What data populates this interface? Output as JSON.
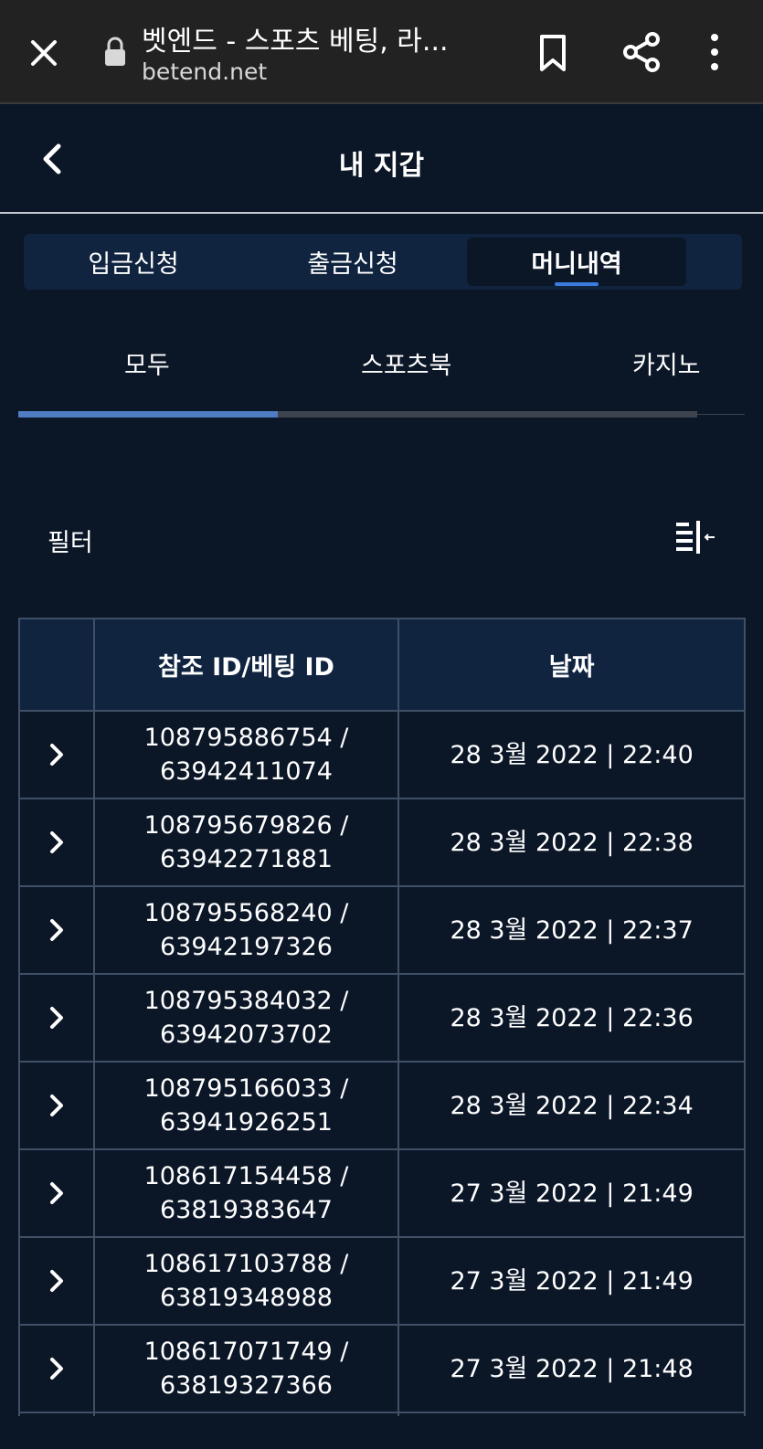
{
  "browser": {
    "title": "벳엔드 - 스포츠 베팅, 라...",
    "url": "betend.net"
  },
  "header": {
    "title": "내 지갑"
  },
  "main_tabs": [
    {
      "label": "입금신청"
    },
    {
      "label": "출금신청"
    },
    {
      "label": "머니내역"
    }
  ],
  "sub_tabs": [
    {
      "label": "모두"
    },
    {
      "label": "스포츠북"
    },
    {
      "label": "카지노"
    }
  ],
  "filter": {
    "label": "필터"
  },
  "table": {
    "headers": {
      "arrow": "",
      "id": "참조 ID/베팅 ID",
      "date": "날짜"
    },
    "rows": [
      {
        "ref": "108795886754 /",
        "bet": "63942411074",
        "date": "28 3월 2022 | 22:40"
      },
      {
        "ref": "108795679826 /",
        "bet": "63942271881",
        "date": "28 3월 2022 | 22:38"
      },
      {
        "ref": "108795568240 /",
        "bet": "63942197326",
        "date": "28 3월 2022 | 22:37"
      },
      {
        "ref": "108795384032 /",
        "bet": "63942073702",
        "date": "28 3월 2022 | 22:36"
      },
      {
        "ref": "108795166033 /",
        "bet": "63941926251",
        "date": "28 3월 2022 | 22:34"
      },
      {
        "ref": "108617154458 /",
        "bet": "63819383647",
        "date": "27 3월 2022 | 21:49"
      },
      {
        "ref": "108617103788 /",
        "bet": "63819348988",
        "date": "27 3월 2022 | 21:49"
      },
      {
        "ref": "108617071749 /",
        "bet": "63819327366",
        "date": "27 3월 2022 | 21:48"
      },
      {
        "ref": "",
        "bet": "",
        "date": ""
      }
    ]
  },
  "colors": {
    "background": "#0b1627",
    "accent": "#3b7be0",
    "header_bg": "#102440"
  }
}
